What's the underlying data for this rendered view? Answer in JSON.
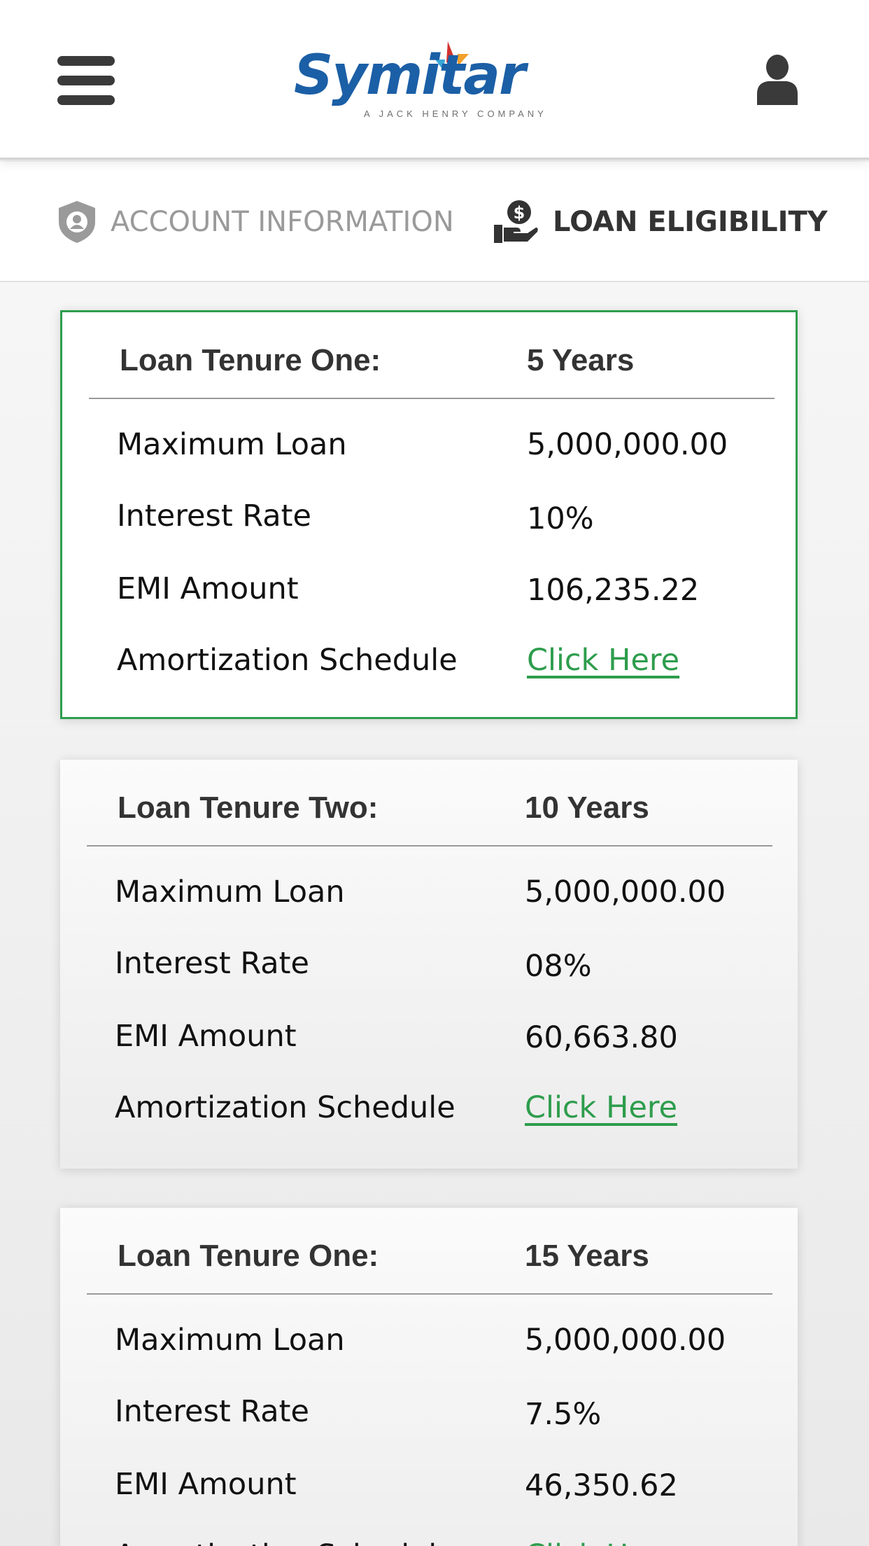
{
  "header": {
    "logo_text": "Symitar",
    "logo_tagline": "A JACK HENRY COMPANY",
    "menu_icon": "hamburger-menu-icon",
    "user_icon": "user-profile-icon"
  },
  "tabs": [
    {
      "label": "ACCOUNT INFORMATION",
      "icon": "shield-user-icon",
      "active": false
    },
    {
      "label": "LOAN ELIGIBILITY",
      "icon": "hand-money-icon",
      "active": true
    }
  ],
  "row_labels": {
    "max_loan": "Maximum Loan",
    "interest": "Interest Rate",
    "emi": "EMI Amount",
    "amortization": "Amortization Schedule"
  },
  "cards": [
    {
      "title": "Loan Tenure One:",
      "years": "5 Years",
      "max_loan": "5,000,000.00",
      "interest": "10%",
      "emi": "106,235.22",
      "link": "Click Here",
      "selected": true
    },
    {
      "title": "Loan Tenure Two:",
      "years": "10 Years",
      "max_loan": "5,000,000.00",
      "interest": "08%",
      "emi": "60,663.80",
      "link": "Click Here",
      "selected": false
    },
    {
      "title": "Loan Tenure One:",
      "years": "15 Years",
      "max_loan": "5,000,000.00",
      "interest": "7.5%",
      "emi": "46,350.62",
      "link": "Click Here",
      "selected": false
    }
  ],
  "colors": {
    "accent_green": "#2e9d4d",
    "logo_blue": "#1b5fa6",
    "text_dark": "#333333",
    "text_muted": "#9a9a9a"
  }
}
